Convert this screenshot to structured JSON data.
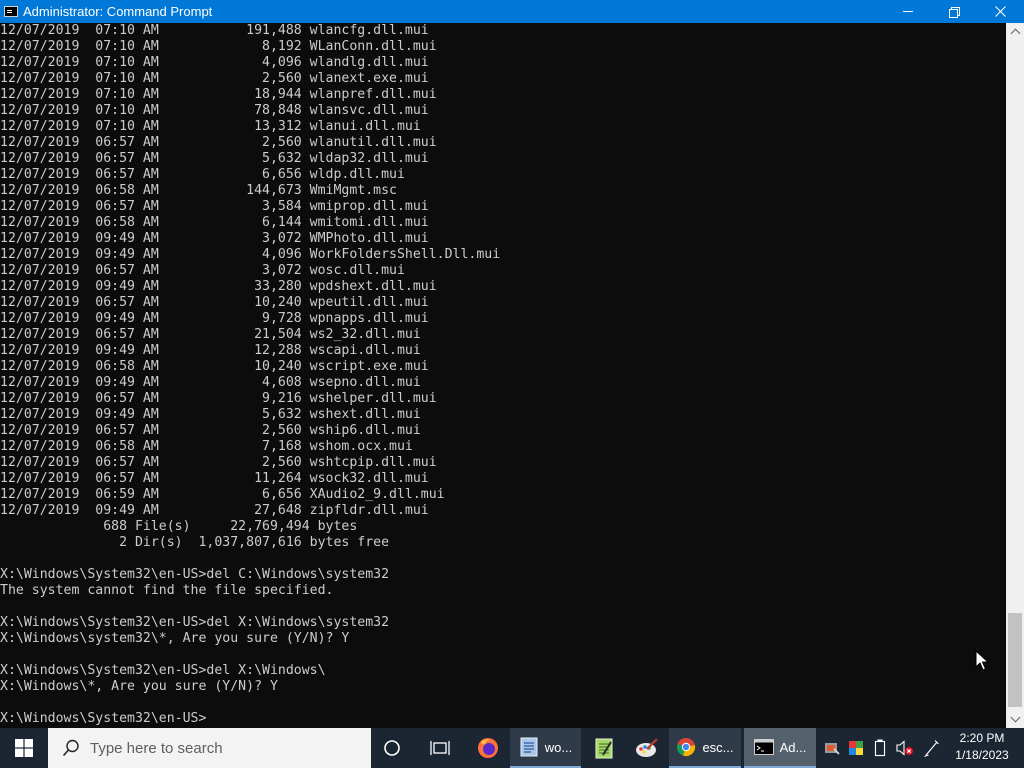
{
  "window": {
    "title": "Administrator: Command Prompt"
  },
  "console": {
    "lines": [
      "12/07/2019  07:10 AM           191,488 wlancfg.dll.mui",
      "12/07/2019  07:10 AM             8,192 WLanConn.dll.mui",
      "12/07/2019  07:10 AM             4,096 wlandlg.dll.mui",
      "12/07/2019  07:10 AM             2,560 wlanext.exe.mui",
      "12/07/2019  07:10 AM            18,944 wlanpref.dll.mui",
      "12/07/2019  07:10 AM            78,848 wlansvc.dll.mui",
      "12/07/2019  07:10 AM            13,312 wlanui.dll.mui",
      "12/07/2019  06:57 AM             2,560 wlanutil.dll.mui",
      "12/07/2019  06:57 AM             5,632 wldap32.dll.mui",
      "12/07/2019  06:57 AM             6,656 wldp.dll.mui",
      "12/07/2019  06:58 AM           144,673 WmiMgmt.msc",
      "12/07/2019  06:57 AM             3,584 wmiprop.dll.mui",
      "12/07/2019  06:58 AM             6,144 wmitomi.dll.mui",
      "12/07/2019  09:49 AM             3,072 WMPhoto.dll.mui",
      "12/07/2019  09:49 AM             4,096 WorkFoldersShell.Dll.mui",
      "12/07/2019  06:57 AM             3,072 wosc.dll.mui",
      "12/07/2019  09:49 AM            33,280 wpdshext.dll.mui",
      "12/07/2019  06:57 AM            10,240 wpeutil.dll.mui",
      "12/07/2019  09:49 AM             9,728 wpnapps.dll.mui",
      "12/07/2019  06:57 AM            21,504 ws2_32.dll.mui",
      "12/07/2019  09:49 AM            12,288 wscapi.dll.mui",
      "12/07/2019  06:58 AM            10,240 wscript.exe.mui",
      "12/07/2019  09:49 AM             4,608 wsepno.dll.mui",
      "12/07/2019  06:57 AM             9,216 wshelper.dll.mui",
      "12/07/2019  09:49 AM             5,632 wshext.dll.mui",
      "12/07/2019  06:57 AM             2,560 wship6.dll.mui",
      "12/07/2019  06:58 AM             7,168 wshom.ocx.mui",
      "12/07/2019  06:57 AM             2,560 wshtcpip.dll.mui",
      "12/07/2019  06:57 AM            11,264 wsock32.dll.mui",
      "12/07/2019  06:59 AM             6,656 XAudio2_9.dll.mui",
      "12/07/2019  09:49 AM            27,648 zipfldr.dll.mui",
      "             688 File(s)     22,769,494 bytes",
      "               2 Dir(s)  1,037,807,616 bytes free",
      "",
      "X:\\Windows\\System32\\en-US>del C:\\Windows\\system32",
      "The system cannot find the file specified.",
      "",
      "X:\\Windows\\System32\\en-US>del X:\\Windows\\system32",
      "X:\\Windows\\system32\\*, Are you sure (Y/N)? Y",
      "",
      "X:\\Windows\\System32\\en-US>del X:\\Windows\\",
      "X:\\Windows\\*, Are you sure (Y/N)? Y",
      "",
      "X:\\Windows\\System32\\en-US>"
    ]
  },
  "taskbar": {
    "search_placeholder": "Type here to search",
    "apps": [
      {
        "label": "wo...",
        "icon": "word-document-icon"
      },
      {
        "label": "esc...",
        "icon": "chrome-icon"
      },
      {
        "label": "Ad...",
        "icon": "command-prompt-icon"
      }
    ],
    "clock": {
      "time": "2:20 PM",
      "date": "1/18/2023"
    }
  },
  "colors": {
    "titlebar": "#0078d7",
    "console_bg": "#0c0c0c",
    "console_text": "#cccccc",
    "taskbar": "#1c2532"
  }
}
